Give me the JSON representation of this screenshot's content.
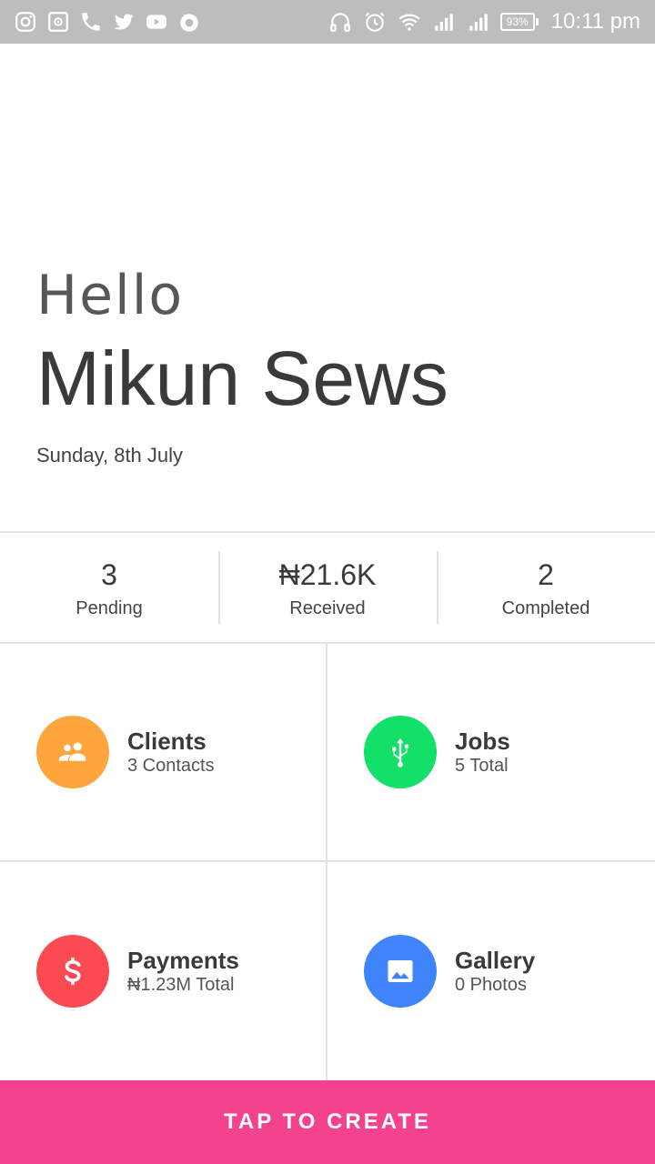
{
  "status_bar": {
    "left_icons": [
      "instagram-icon",
      "screenshot-icon",
      "phone-icon",
      "twitter-icon",
      "youtube-icon",
      "firefox-icon"
    ],
    "right_icons": [
      "headphones-icon",
      "alarm-icon",
      "wifi-icon",
      "signal-icon",
      "signal-icon-2"
    ],
    "battery": "93%",
    "time": "10:11 pm",
    "background": "#bdbdbd"
  },
  "greeting": {
    "hello": "Hello",
    "name": "Mikun Sews",
    "date": "Sunday, 8th July"
  },
  "stats": [
    {
      "value": "3",
      "label": "Pending"
    },
    {
      "value": "₦21.6K",
      "label": "Received"
    },
    {
      "value": "2",
      "label": "Completed"
    }
  ],
  "tiles": [
    {
      "title": "Clients",
      "subtitle": "3 Contacts",
      "icon": "people-icon",
      "color": "#ffa53b"
    },
    {
      "title": "Jobs",
      "subtitle": "5 Total",
      "icon": "usb-icon",
      "color": "#13e068"
    },
    {
      "title": "Payments",
      "subtitle": "₦1.23M Total",
      "icon": "dollar-icon",
      "color": "#fb4a51"
    },
    {
      "title": "Gallery",
      "subtitle": "0 Photos",
      "icon": "image-icon",
      "color": "#3f84fc"
    }
  ],
  "cta": {
    "label": "TAP TO CREATE",
    "color": "#f5428e"
  }
}
